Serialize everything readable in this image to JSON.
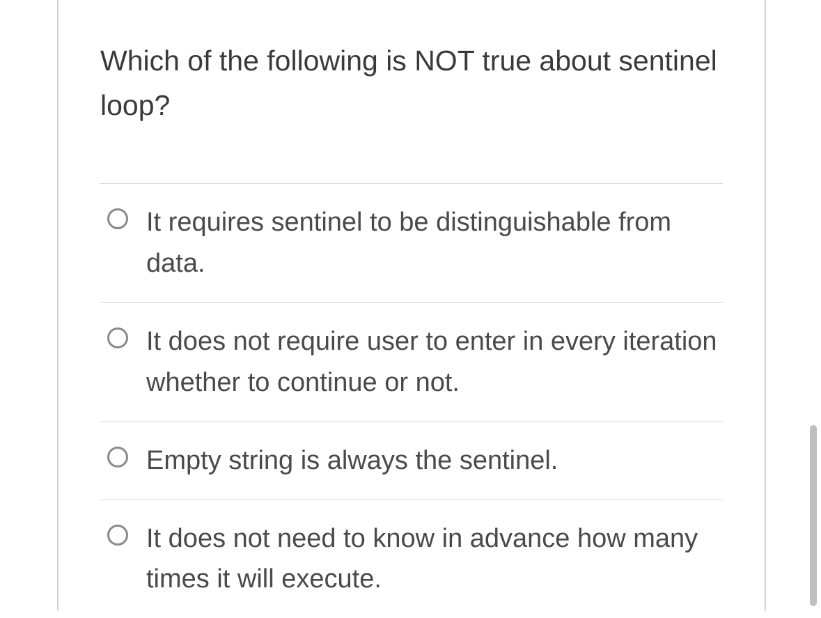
{
  "question": {
    "prompt": "Which of the following is NOT true about sentinel loop?",
    "options": [
      {
        "label": "It requires sentinel to be distinguishable from data."
      },
      {
        "label": "It does not require user to enter in every iteration whether to continue or not."
      },
      {
        "label": "Empty string is always the sentinel."
      },
      {
        "label": "It does not need to know in advance how many times it will execute."
      }
    ]
  }
}
